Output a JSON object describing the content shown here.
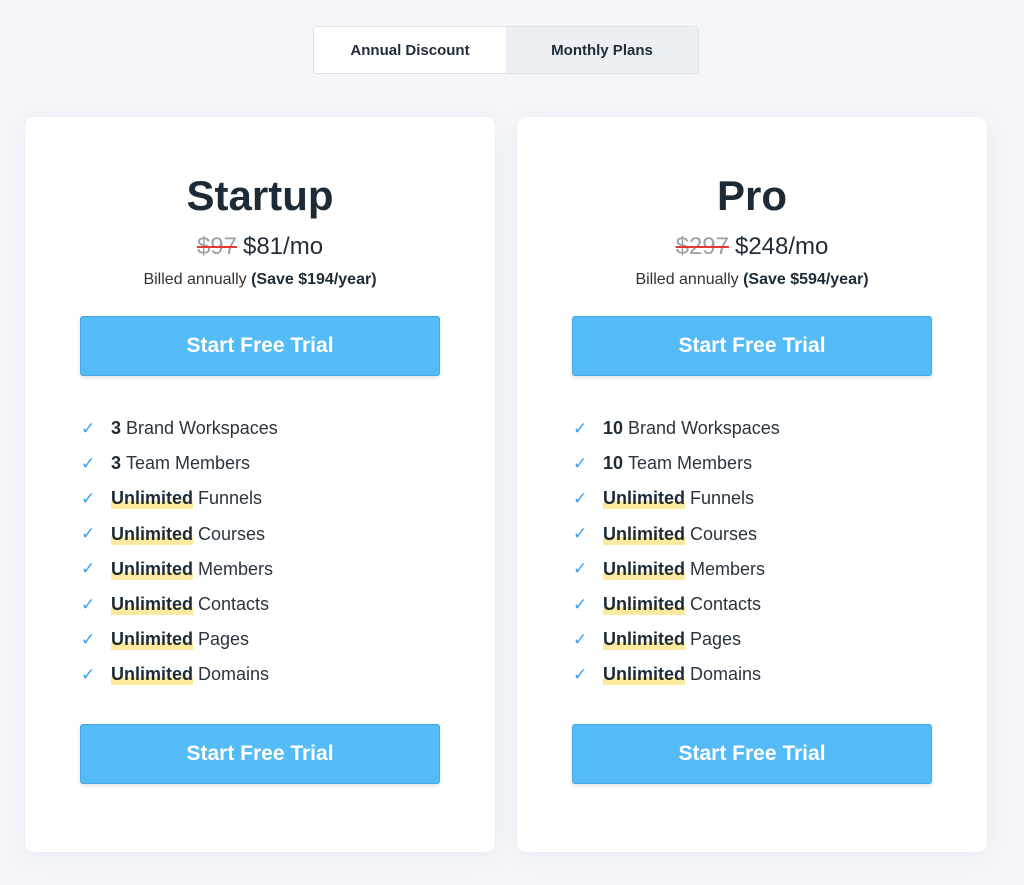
{
  "toggle": {
    "options": [
      {
        "label": "Annual Discount",
        "active": true
      },
      {
        "label": "Monthly Plans",
        "active": false
      }
    ]
  },
  "plans": [
    {
      "name": "Startup",
      "old_price": "$97",
      "price": "$81/mo",
      "billed": "Billed annually",
      "save": "(Save $194/year)",
      "cta": "Start Free Trial",
      "features": [
        [
          "3",
          "Brand Workspaces"
        ],
        [
          "3",
          "Team Members"
        ],
        [
          "Unlimited",
          "Funnels"
        ],
        [
          "Unlimited",
          "Courses"
        ],
        [
          "Unlimited",
          "Members"
        ],
        [
          "Unlimited",
          "Contacts"
        ],
        [
          "Unlimited",
          "Pages"
        ],
        [
          "Unlimited",
          "Domains"
        ]
      ]
    },
    {
      "name": "Pro",
      "old_price": "$297",
      "price": "$248/mo",
      "billed": "Billed annually",
      "save": "(Save $594/year)",
      "cta": "Start Free Trial",
      "features": [
        [
          "10",
          "Brand Workspaces"
        ],
        [
          "10",
          "Team Members"
        ],
        [
          "Unlimited",
          "Funnels"
        ],
        [
          "Unlimited",
          "Courses"
        ],
        [
          "Unlimited",
          "Members"
        ],
        [
          "Unlimited",
          "Contacts"
        ],
        [
          "Unlimited",
          "Pages"
        ],
        [
          "Unlimited",
          "Domains"
        ]
      ]
    }
  ],
  "icons": {
    "feature": "check-icon"
  },
  "colors": {
    "button": "#55bbf7",
    "check": "#3aa0ea",
    "highlight": "#fbe9a0",
    "strike": "#e53935"
  }
}
